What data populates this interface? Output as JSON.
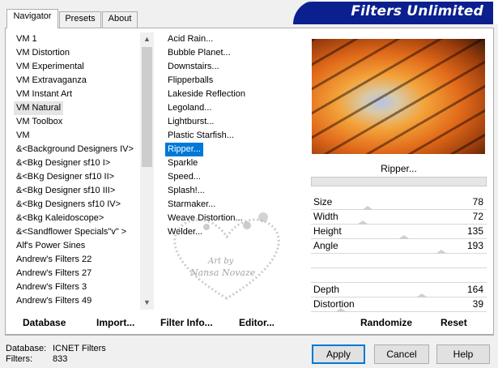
{
  "tabs": [
    {
      "label": "Navigator",
      "active": true
    },
    {
      "label": "Presets",
      "active": false
    },
    {
      "label": "About",
      "active": false
    }
  ],
  "brand": {
    "title": "Filters Unlimited",
    "color": "#0b1f8f"
  },
  "categories": [
    "VM 1",
    "VM Distortion",
    "VM Experimental",
    "VM Extravaganza",
    "VM Instant Art",
    "VM Natural",
    "VM Toolbox",
    "VM",
    "&<Background Designers IV>",
    "&<Bkg Designer sf10 I>",
    "&<BKg Designer sf10 II>",
    "&<Bkg Designer sf10 III>",
    "&<Bkg Designers sf10 IV>",
    "&<Bkg Kaleidoscope>",
    "&<Sandflower Specials\"v\" >",
    "Alf's Power Sines",
    "Andrew's Filters 22",
    "Andrew's Filters 27",
    "Andrew's Filters 3",
    "Andrew's Filters 49"
  ],
  "selected_category": "VM Natural",
  "filters": [
    "Acid Rain...",
    "Bubble Planet...",
    "Downstairs...",
    "Flipperballs",
    "Lakeside Reflection",
    "Legoland...",
    "Lightburst...",
    "Plastic Starfish...",
    "Ripper...",
    "Sparkle",
    "Speed...",
    "Splash!...",
    "Starmaker...",
    "Weave Distortion...",
    "Welder..."
  ],
  "selected_filter": "Ripper...",
  "preview": {
    "filter_name": "Ripper..."
  },
  "sliders": [
    {
      "label": "Size",
      "value": "78",
      "fraction": 0.31
    },
    {
      "label": "Width",
      "value": "72",
      "fraction": 0.28
    },
    {
      "label": "Height",
      "value": "135",
      "fraction": 0.53
    },
    {
      "label": "Angle",
      "value": "193",
      "fraction": 0.76
    },
    {
      "label": "",
      "value": "",
      "fraction": null
    },
    {
      "label": "",
      "value": "",
      "fraction": null
    },
    {
      "label": "Depth",
      "value": "164",
      "fraction": 0.64
    },
    {
      "label": "Distortion",
      "value": "39",
      "fraction": 0.15
    }
  ],
  "actions": {
    "database": "Database",
    "import": "Import...",
    "filter_info": "Filter Info...",
    "editor": "Editor...",
    "randomize": "Randomize",
    "reset": "Reset"
  },
  "status": {
    "database_label": "Database:",
    "database_value": "ICNET Filters",
    "filters_label": "Filters:",
    "filters_value": "833"
  },
  "buttons": {
    "apply": "Apply",
    "cancel": "Cancel",
    "help": "Help"
  },
  "watermark": {
    "line1": "Art by",
    "line2": "Nansa Novaze"
  }
}
